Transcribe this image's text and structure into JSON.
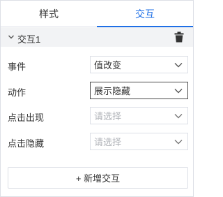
{
  "tabs": [
    {
      "label": "样式",
      "active": false
    },
    {
      "label": "交互",
      "active": true
    }
  ],
  "accent_color": "#1e6fe6",
  "section": {
    "title": "交互1",
    "collapse_icon": "chevron-down-icon",
    "delete_icon": "trash-icon"
  },
  "fields": {
    "event": {
      "label": "事件",
      "value": "值改变"
    },
    "action": {
      "label": "动作",
      "value": "展示隐藏"
    },
    "show": {
      "label": "点击出现",
      "placeholder": "请选择"
    },
    "hide": {
      "label": "点击隐藏",
      "placeholder": "请选择"
    }
  },
  "add_button": {
    "label": "+ 新增交互"
  }
}
